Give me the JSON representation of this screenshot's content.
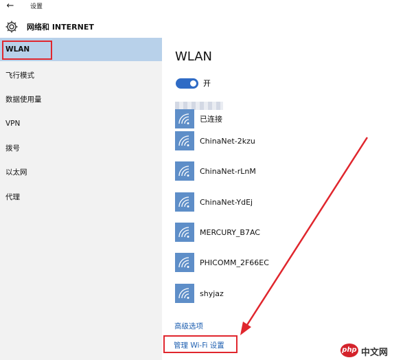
{
  "titlebar": {
    "title": "设置"
  },
  "section": {
    "title": "网络和 INTERNET"
  },
  "sidebar": {
    "items": [
      {
        "label": "WLAN"
      },
      {
        "label": "飞行模式"
      },
      {
        "label": "数据使用量"
      },
      {
        "label": "VPN"
      },
      {
        "label": "拨号"
      },
      {
        "label": "以太网"
      },
      {
        "label": "代理"
      }
    ]
  },
  "main": {
    "title": "WLAN",
    "toggle_label": "开",
    "toggle_on": true,
    "networks": [
      {
        "status": "已连接"
      },
      {
        "name": "ChinaNet-2kzu"
      },
      {
        "name": "ChinaNet-rLnM"
      },
      {
        "name": "ChinaNet-YdEj"
      },
      {
        "name": "MERCURY_B7AC"
      },
      {
        "name": "PHICOMM_2F66EC"
      },
      {
        "name": "shyjaz"
      }
    ],
    "advanced_link": "高级选项",
    "manage_link": "管理 Wi-Fi 设置"
  },
  "watermark": {
    "logo": "php",
    "text": "中文网"
  },
  "colors": {
    "accent": "#2f6bc5",
    "selected": "#b8d1ea",
    "highlight_box": "#e0262d",
    "wifi_tile": "#5e8ec8",
    "link": "#1e5fb0"
  }
}
